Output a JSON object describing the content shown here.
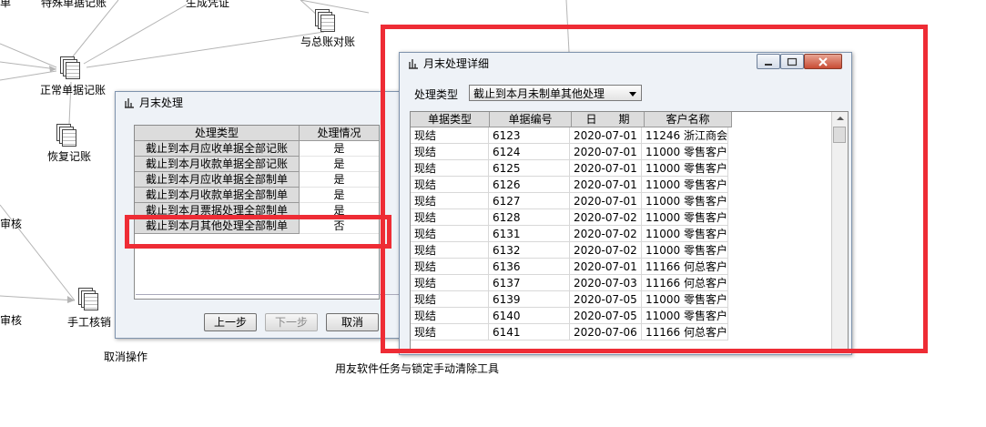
{
  "flowchart": {
    "nodes": [
      {
        "label": "特殊单据记账"
      },
      {
        "label": "生成凭证"
      },
      {
        "label": "与总账对账"
      },
      {
        "label": "正常单据记账"
      },
      {
        "label": "恢复记账"
      },
      {
        "label": "手工核销"
      },
      {
        "label": "取消操作"
      },
      {
        "label": "用友软件任务与锁定手动清除工具"
      },
      {
        "label": "单"
      },
      {
        "label": "审核"
      },
      {
        "label": "审核"
      }
    ]
  },
  "month_end_dialog": {
    "title": "月末处理",
    "columns": [
      "处理类型",
      "处理情况"
    ],
    "rows": [
      {
        "type": "截止到本月应收单据全部记账",
        "status": "是"
      },
      {
        "type": "截止到本月收款单据全部记账",
        "status": "是"
      },
      {
        "type": "截止到本月应收单据全部制单",
        "status": "是"
      },
      {
        "type": "截止到本月收款单据全部制单",
        "status": "是"
      },
      {
        "type": "截止到本月票据处理全部制单",
        "status": "是"
      },
      {
        "type": "截止到本月其他处理全部制单",
        "status": "否"
      }
    ],
    "buttons": {
      "prev": "上一步",
      "next": "下一步",
      "cancel": "取消"
    }
  },
  "detail_window": {
    "title": "月末处理详细",
    "filter_label": "处理类型",
    "filter_value": "截止到本月未制单其他处理",
    "columns": [
      "单据类型",
      "单据编号",
      "日　　期",
      "客户名称"
    ],
    "rows": [
      {
        "type": "现结",
        "no": "6123",
        "date": "2020-07-01",
        "customer": "11246 浙江商会"
      },
      {
        "type": "现结",
        "no": "6124",
        "date": "2020-07-01",
        "customer": "11000 零售客户"
      },
      {
        "type": "现结",
        "no": "6125",
        "date": "2020-07-01",
        "customer": "11000 零售客户"
      },
      {
        "type": "现结",
        "no": "6126",
        "date": "2020-07-01",
        "customer": "11000 零售客户"
      },
      {
        "type": "现结",
        "no": "6127",
        "date": "2020-07-01",
        "customer": "11000 零售客户"
      },
      {
        "type": "现结",
        "no": "6128",
        "date": "2020-07-02",
        "customer": "11000 零售客户"
      },
      {
        "type": "现结",
        "no": "6131",
        "date": "2020-07-02",
        "customer": "11000 零售客户"
      },
      {
        "type": "现结",
        "no": "6132",
        "date": "2020-07-02",
        "customer": "11000 零售客户"
      },
      {
        "type": "现结",
        "no": "6136",
        "date": "2020-07-01",
        "customer": "11166 何总客户"
      },
      {
        "type": "现结",
        "no": "6137",
        "date": "2020-07-03",
        "customer": "11166 何总客户"
      },
      {
        "type": "现结",
        "no": "6139",
        "date": "2020-07-05",
        "customer": "11000 零售客户"
      },
      {
        "type": "现结",
        "no": "6140",
        "date": "2020-07-05",
        "customer": "11000 零售客户"
      },
      {
        "type": "现结",
        "no": "6141",
        "date": "2020-07-06",
        "customer": "11166 何总客户"
      }
    ]
  },
  "colors": {
    "highlight": "#ee2c35",
    "window_bg": "#eef2f7"
  }
}
